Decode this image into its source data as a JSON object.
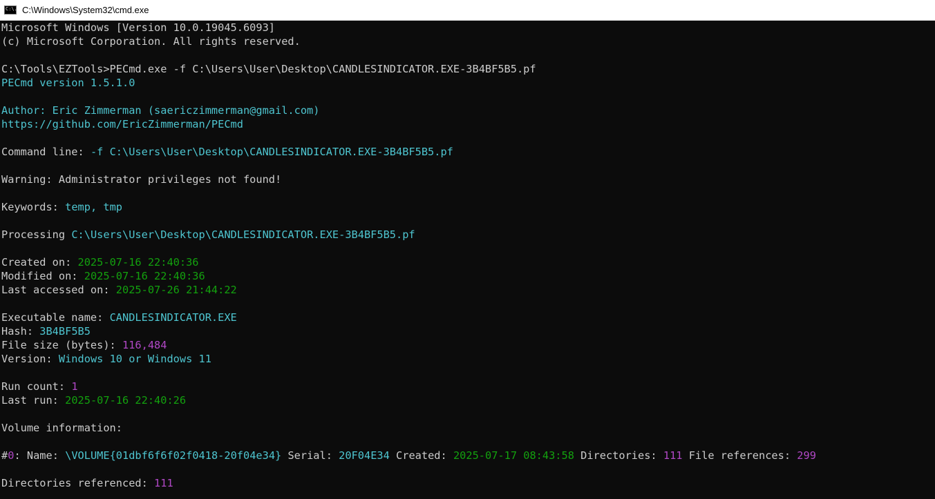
{
  "window": {
    "title": "C:\\Windows\\System32\\cmd.exe",
    "icon": "cmd-icon",
    "icon_text": "C:\\."
  },
  "colors": {
    "background": "#0c0c0c",
    "default": "#cccccc",
    "cyan": "#4ec5d0",
    "green": "#13a10e",
    "magenta": "#b148c6"
  },
  "lines": [
    [
      {
        "t": "Microsoft Windows [Version 10.0.19045.6093]",
        "c": "white"
      }
    ],
    [
      {
        "t": "(c) Microsoft Corporation. All rights reserved.",
        "c": "white"
      }
    ],
    [],
    [
      {
        "t": "C:\\Tools\\EZTools>PECmd.exe -f C:\\Users\\User\\Desktop\\CANDLESINDICATOR.EXE-3B4BF5B5.pf",
        "c": "white"
      }
    ],
    [
      {
        "t": "PECmd version 1.5.1.0",
        "c": "cyan"
      }
    ],
    [],
    [
      {
        "t": "Author: Eric Zimmerman (saericzimmerman@gmail.com)",
        "c": "cyan"
      }
    ],
    [
      {
        "t": "https://github.com/EricZimmerman/PECmd",
        "c": "cyan"
      }
    ],
    [],
    [
      {
        "t": "Command line: ",
        "c": "white"
      },
      {
        "t": "-f C:\\Users\\User\\Desktop\\CANDLESINDICATOR.EXE-3B4BF5B5.pf",
        "c": "cyan"
      }
    ],
    [],
    [
      {
        "t": "Warning: Administrator privileges not found!",
        "c": "white"
      }
    ],
    [],
    [
      {
        "t": "Keywords: ",
        "c": "white"
      },
      {
        "t": "temp, tmp",
        "c": "cyan"
      }
    ],
    [],
    [
      {
        "t": "Processing ",
        "c": "white"
      },
      {
        "t": "C:\\Users\\User\\Desktop\\CANDLESINDICATOR.EXE-3B4BF5B5.pf",
        "c": "cyan"
      }
    ],
    [],
    [
      {
        "t": "Created on: ",
        "c": "white"
      },
      {
        "t": "2025-07-16 22:40:36",
        "c": "green"
      }
    ],
    [
      {
        "t": "Modified on: ",
        "c": "white"
      },
      {
        "t": "2025-07-16 22:40:36",
        "c": "green"
      }
    ],
    [
      {
        "t": "Last accessed on: ",
        "c": "white"
      },
      {
        "t": "2025-07-26 21:44:22",
        "c": "green"
      }
    ],
    [],
    [
      {
        "t": "Executable name: ",
        "c": "white"
      },
      {
        "t": "CANDLESINDICATOR.EXE",
        "c": "cyan"
      }
    ],
    [
      {
        "t": "Hash: ",
        "c": "white"
      },
      {
        "t": "3B4BF5B5",
        "c": "cyan"
      }
    ],
    [
      {
        "t": "File size (bytes): ",
        "c": "white"
      },
      {
        "t": "116,484",
        "c": "magenta"
      }
    ],
    [
      {
        "t": "Version: ",
        "c": "white"
      },
      {
        "t": "Windows 10 or Windows 11",
        "c": "cyan"
      }
    ],
    [],
    [
      {
        "t": "Run count: ",
        "c": "white"
      },
      {
        "t": "1",
        "c": "magenta"
      }
    ],
    [
      {
        "t": "Last run: ",
        "c": "white"
      },
      {
        "t": "2025-07-16 22:40:26",
        "c": "green"
      }
    ],
    [],
    [
      {
        "t": "Volume information:",
        "c": "white"
      }
    ],
    [],
    [
      {
        "t": "#",
        "c": "white"
      },
      {
        "t": "0",
        "c": "magenta"
      },
      {
        "t": ": Name: ",
        "c": "white"
      },
      {
        "t": "\\VOLUME{01dbf6f6f02f0418-20f04e34}",
        "c": "cyan"
      },
      {
        "t": " Serial: ",
        "c": "white"
      },
      {
        "t": "20F04E34",
        "c": "cyan"
      },
      {
        "t": " Created: ",
        "c": "white"
      },
      {
        "t": "2025-07-17 08:43:58",
        "c": "green"
      },
      {
        "t": " Directories: ",
        "c": "white"
      },
      {
        "t": "111",
        "c": "magenta"
      },
      {
        "t": " File references: ",
        "c": "white"
      },
      {
        "t": "299",
        "c": "magenta"
      }
    ],
    [],
    [
      {
        "t": "Directories referenced: ",
        "c": "white"
      },
      {
        "t": "111",
        "c": "magenta"
      }
    ]
  ]
}
